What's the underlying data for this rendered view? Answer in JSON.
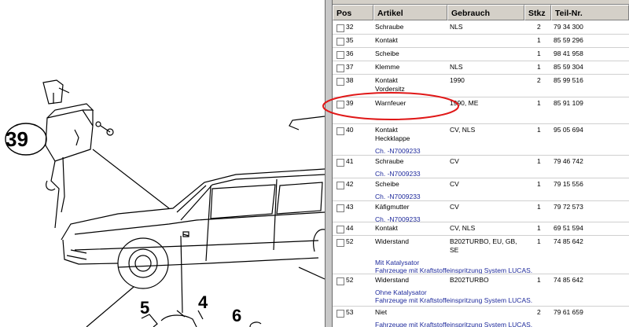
{
  "diagram": {
    "callouts": [
      {
        "id": "39",
        "label": "39"
      },
      {
        "id": "5",
        "label": "5"
      },
      {
        "id": "4",
        "label": "4"
      },
      {
        "id": "6",
        "label": "6"
      }
    ]
  },
  "table": {
    "columns": [
      "Pos",
      "Artikel",
      "Gebrauch",
      "Stkz",
      "Teil-Nr."
    ],
    "rows": [
      {
        "pos": "32",
        "artikel": [
          "Schraube"
        ],
        "gebrauch": [
          "NLS"
        ],
        "stkz": "2",
        "teilnr": "79 34 300",
        "notes": []
      },
      {
        "pos": "35",
        "artikel": [
          "Kontakt"
        ],
        "gebrauch": [],
        "stkz": "1",
        "teilnr": "85 59 296",
        "notes": []
      },
      {
        "pos": "36",
        "artikel": [
          "Scheibe"
        ],
        "gebrauch": [],
        "stkz": "1",
        "teilnr": "98 41 958",
        "notes": []
      },
      {
        "pos": "37",
        "artikel": [
          "Klemme"
        ],
        "gebrauch": [
          "NLS"
        ],
        "stkz": "1",
        "teilnr": "85 59 304",
        "notes": []
      },
      {
        "pos": "38",
        "artikel": [
          "Kontakt",
          "Vordersitz"
        ],
        "gebrauch": [
          "1990"
        ],
        "stkz": "2",
        "teilnr": "85 99 516",
        "notes": []
      },
      {
        "pos": "39",
        "artikel": [
          "Warnfeuer"
        ],
        "gebrauch": [
          "1990, ME"
        ],
        "stkz": "1",
        "teilnr": "85 91 109",
        "notes": []
      },
      {
        "pos": "40",
        "artikel": [
          "Kontakt",
          "Heckklappe"
        ],
        "gebrauch": [
          "CV, NLS"
        ],
        "stkz": "1",
        "teilnr": "95 05 694",
        "notes": [
          "Ch. -N7009233"
        ]
      },
      {
        "pos": "41",
        "artikel": [
          "Schraube"
        ],
        "gebrauch": [
          "CV"
        ],
        "stkz": "1",
        "teilnr": "79 46 742",
        "notes": [
          "Ch. -N7009233"
        ]
      },
      {
        "pos": "42",
        "artikel": [
          "Scheibe"
        ],
        "gebrauch": [
          "CV"
        ],
        "stkz": "1",
        "teilnr": "79 15 556",
        "notes": [
          "Ch. -N7009233"
        ]
      },
      {
        "pos": "43",
        "artikel": [
          "Käfigmutter"
        ],
        "gebrauch": [
          "CV"
        ],
        "stkz": "1",
        "teilnr": "79 72 573",
        "notes": [
          "Ch. -N7009233"
        ]
      },
      {
        "pos": "44",
        "artikel": [
          "Kontakt"
        ],
        "gebrauch": [
          "CV, NLS"
        ],
        "stkz": "1",
        "teilnr": "69 51 594",
        "notes": []
      },
      {
        "pos": "52",
        "artikel": [
          "Widerstand"
        ],
        "gebrauch": [
          "B202TURBO, EU, GB,",
          "SE"
        ],
        "stkz": "1",
        "teilnr": "74 85 642",
        "notes": [
          "Mit Katalysator",
          "Fahrzeuge mit Kraftstoffeinspritzung System LUCAS."
        ]
      },
      {
        "pos": "52",
        "artikel": [
          "Widerstand"
        ],
        "gebrauch": [
          "B202TURBO"
        ],
        "stkz": "1",
        "teilnr": "74 85 642",
        "notes": [
          "Ohne Katalysator",
          "Fahrzeuge mit Kraftstoffeinspritzung System LUCAS."
        ]
      },
      {
        "pos": "53",
        "artikel": [
          "Niet"
        ],
        "gebrauch": [],
        "stkz": "2",
        "teilnr": "79 61 659",
        "notes": [
          "Fahrzeuge mit Kraftstoffeinspritzung System LUCAS."
        ]
      }
    ]
  },
  "colors": {
    "highlight": "#e01818",
    "note": "#1e2a9c",
    "header": "#d4d0c8"
  }
}
